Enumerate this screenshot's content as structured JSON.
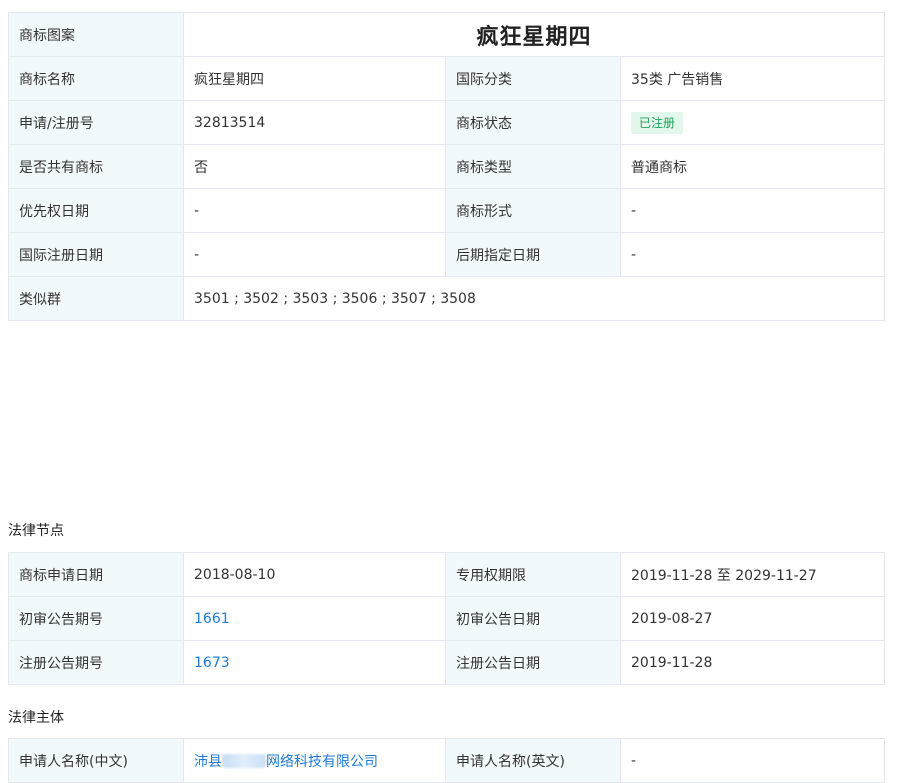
{
  "basic": {
    "logo_label": "商标图案",
    "logo_text": "疯狂星期四",
    "rows": [
      {
        "l1": "商标名称",
        "v1": "疯狂星期四",
        "l2": "国际分类",
        "v2": "35类 广告销售"
      },
      {
        "l1": "申请/注册号",
        "v1": "32813514",
        "l2": "商标状态",
        "v2": "已注册"
      },
      {
        "l1": "是否共有商标",
        "v1": "否",
        "l2": "商标类型",
        "v2": "普通商标"
      },
      {
        "l1": "优先权日期",
        "v1": "-",
        "l2": "商标形式",
        "v2": "-"
      },
      {
        "l1": "国际注册日期",
        "v1": "-",
        "l2": "后期指定日期",
        "v2": "-"
      }
    ],
    "similar_label": "类似群",
    "similar_value": "3501 ; 3502 ; 3503 ; 3506 ; 3507 ; 3508"
  },
  "legal_nodes": {
    "title": "法律节点",
    "rows": [
      {
        "l1": "商标申请日期",
        "v1": "2018-08-10",
        "l2": "专用权期限",
        "v2": "2019-11-28 至 2029-11-27"
      },
      {
        "l1": "初审公告期号",
        "v1": "1661",
        "l2": "初审公告日期",
        "v2": "2019-08-27"
      },
      {
        "l1": "注册公告期号",
        "v1": "1673",
        "l2": "注册公告日期",
        "v2": "2019-11-28"
      }
    ]
  },
  "legal_subject": {
    "title": "法律主体",
    "rows": [
      {
        "l1": "申请人名称(中文)",
        "v1_prefix": "沛县",
        "v1_suffix": "网络科技有限公司",
        "l2": "申请人名称(英文)",
        "v2": "-"
      }
    ]
  },
  "colors": {
    "label_bg": "#f2f9fc",
    "border": "#e4e8ee",
    "link": "#1e7bd6",
    "badge_text": "#1aa35b",
    "badge_bg": "#e4f7ec"
  }
}
